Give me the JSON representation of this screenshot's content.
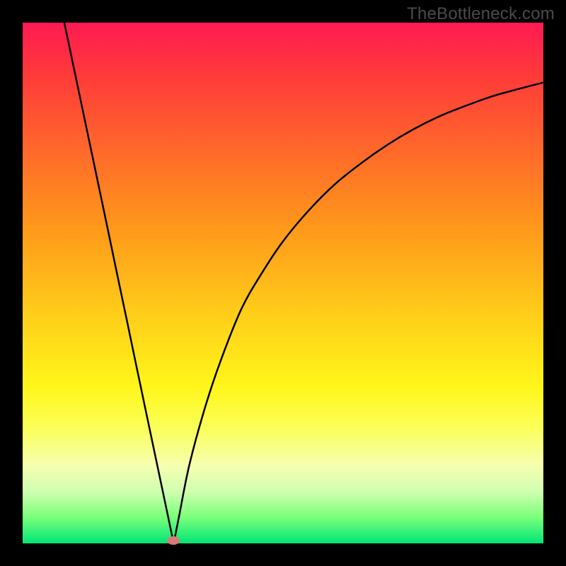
{
  "watermark": "TheBottleneck.com",
  "colors": {
    "frame": "#000000",
    "curve": "#000000",
    "marker": "#d97a7a",
    "gradient_top": "#ff1a52",
    "gradient_bottom": "#00e676"
  },
  "chart_data": {
    "type": "line",
    "title": "",
    "xlabel": "",
    "ylabel": "",
    "xlim": [
      0,
      100
    ],
    "ylim": [
      0,
      100
    ],
    "grid": false,
    "legend": false,
    "minimum_point": {
      "x": 29,
      "y": 0
    },
    "marker": {
      "x": 29,
      "y": 0.5
    },
    "series": [
      {
        "name": "left-branch",
        "x": [
          8,
          10,
          12,
          14,
          16,
          18,
          20,
          22,
          24,
          26,
          28,
          29
        ],
        "y": [
          100,
          90.5,
          81,
          71.5,
          62,
          52.4,
          42.9,
          33.3,
          23.8,
          14.3,
          4.8,
          0
        ]
      },
      {
        "name": "right-branch",
        "x": [
          29,
          30,
          32,
          35,
          38,
          42,
          46,
          50,
          55,
          60,
          65,
          70,
          75,
          80,
          85,
          90,
          95,
          100
        ],
        "y": [
          0,
          5,
          15,
          26,
          35,
          45,
          52,
          58,
          64,
          69,
          73,
          76.5,
          79.5,
          82,
          84,
          85.8,
          87.2,
          88.5
        ]
      }
    ],
    "annotations": []
  }
}
